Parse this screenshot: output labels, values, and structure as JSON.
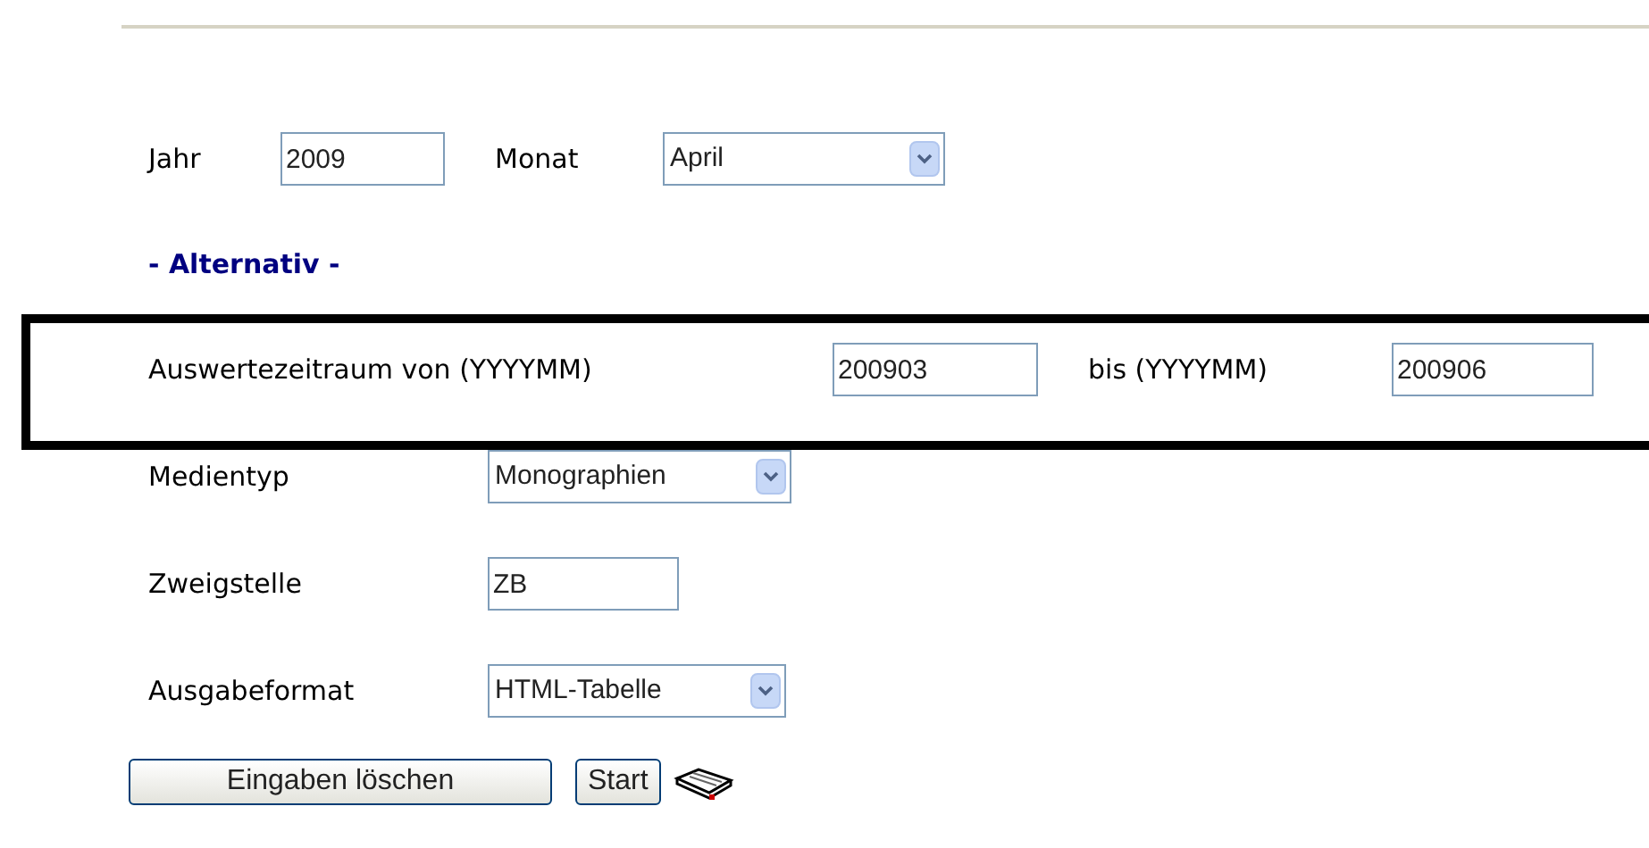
{
  "rows": [
    {
      "highlighted": false,
      "fields": [
        {
          "label": "Jahr",
          "kind": "text",
          "value": "2009"
        },
        {
          "label": "Monat",
          "kind": "select",
          "value": "April"
        }
      ]
    },
    {
      "kind": "heading",
      "text": "- Alternativ -"
    },
    {
      "highlighted": true,
      "fields": [
        {
          "label": "Auswertezeitraum von (YYYYMM)",
          "kind": "text",
          "value": "200903"
        },
        {
          "label": "bis (YYYYMM)",
          "kind": "text",
          "value": "200906"
        }
      ]
    },
    {
      "highlighted": false,
      "fields": [
        {
          "label": "Medientyp",
          "kind": "select",
          "value": "Monographien"
        }
      ]
    },
    {
      "highlighted": false,
      "fields": [
        {
          "label": "Zweigstelle",
          "kind": "text",
          "value": "ZB"
        }
      ]
    },
    {
      "highlighted": false,
      "fields": [
        {
          "label": "Ausgabeformat",
          "kind": "select",
          "value": "HTML-Tabelle"
        }
      ]
    }
  ],
  "buttons": [
    "Eingaben löschen",
    "Start"
  ]
}
